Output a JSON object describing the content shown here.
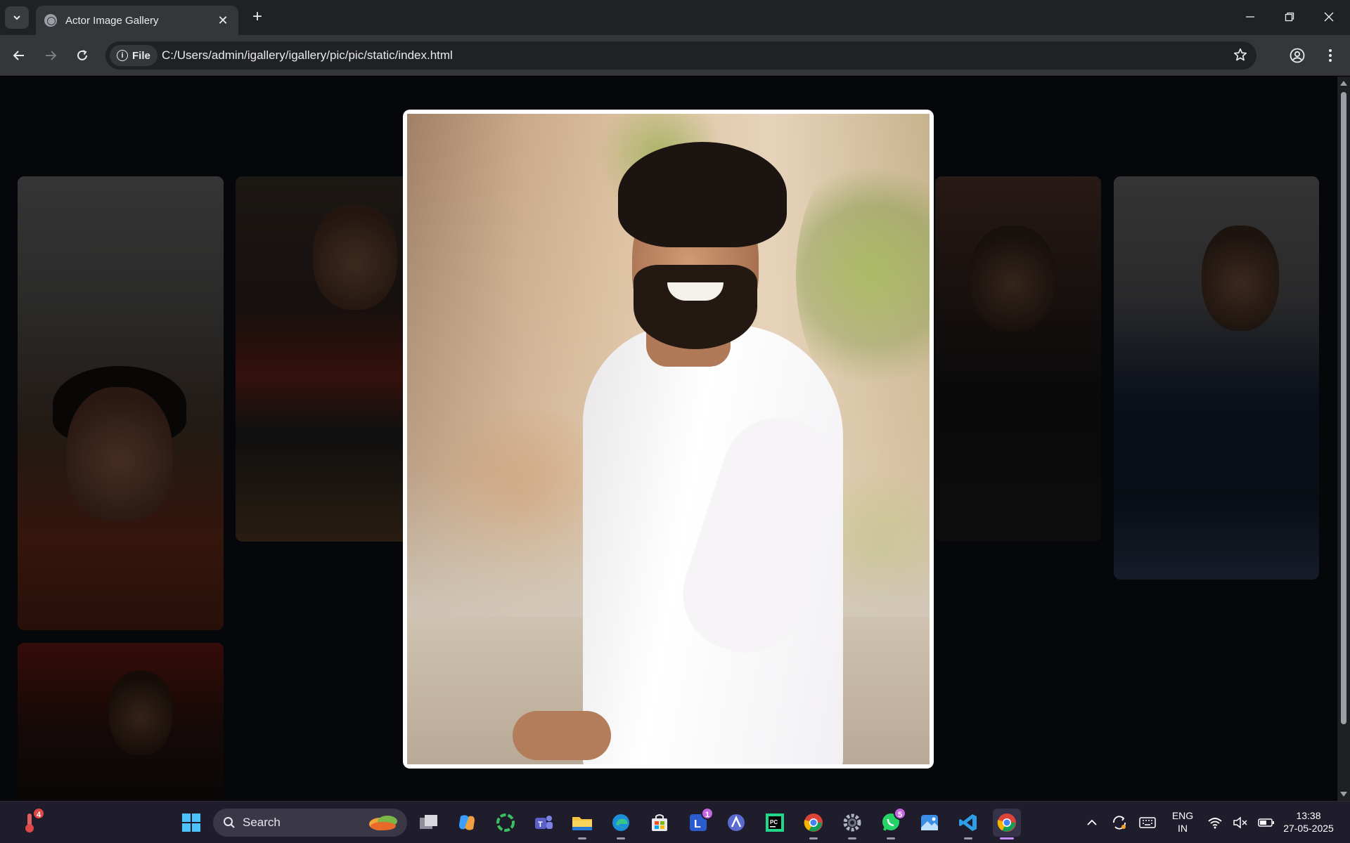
{
  "browser": {
    "tab_title": "Actor Image Gallery",
    "new_tab_label": "+",
    "close_tab_label": "✕",
    "chip_label": "File",
    "url": "C:/Users/admin/igallery/igallery/pic/pic/static/index.html"
  },
  "gallery": {
    "thumbnails": [
      {
        "icon": "actor-photo"
      },
      {
        "icon": "actor-photo"
      },
      {
        "icon": "actor-photo"
      },
      {
        "icon": "actor-photo"
      },
      {
        "icon": "actor-photo"
      }
    ],
    "lightbox": {
      "icon": "actor-photo-enlarged"
    }
  },
  "taskbar": {
    "weather_badge": "4",
    "search_placeholder": "Search",
    "badges": {
      "l_app": "1",
      "whatsapp": "5"
    },
    "language": {
      "line1": "ENG",
      "line2": "IN"
    },
    "time": "13:38",
    "date": "27-05-2025"
  },
  "colors": {
    "accent": "#c48cf0",
    "chrome_bg": "#202124",
    "toolbar_bg": "#35363a"
  }
}
